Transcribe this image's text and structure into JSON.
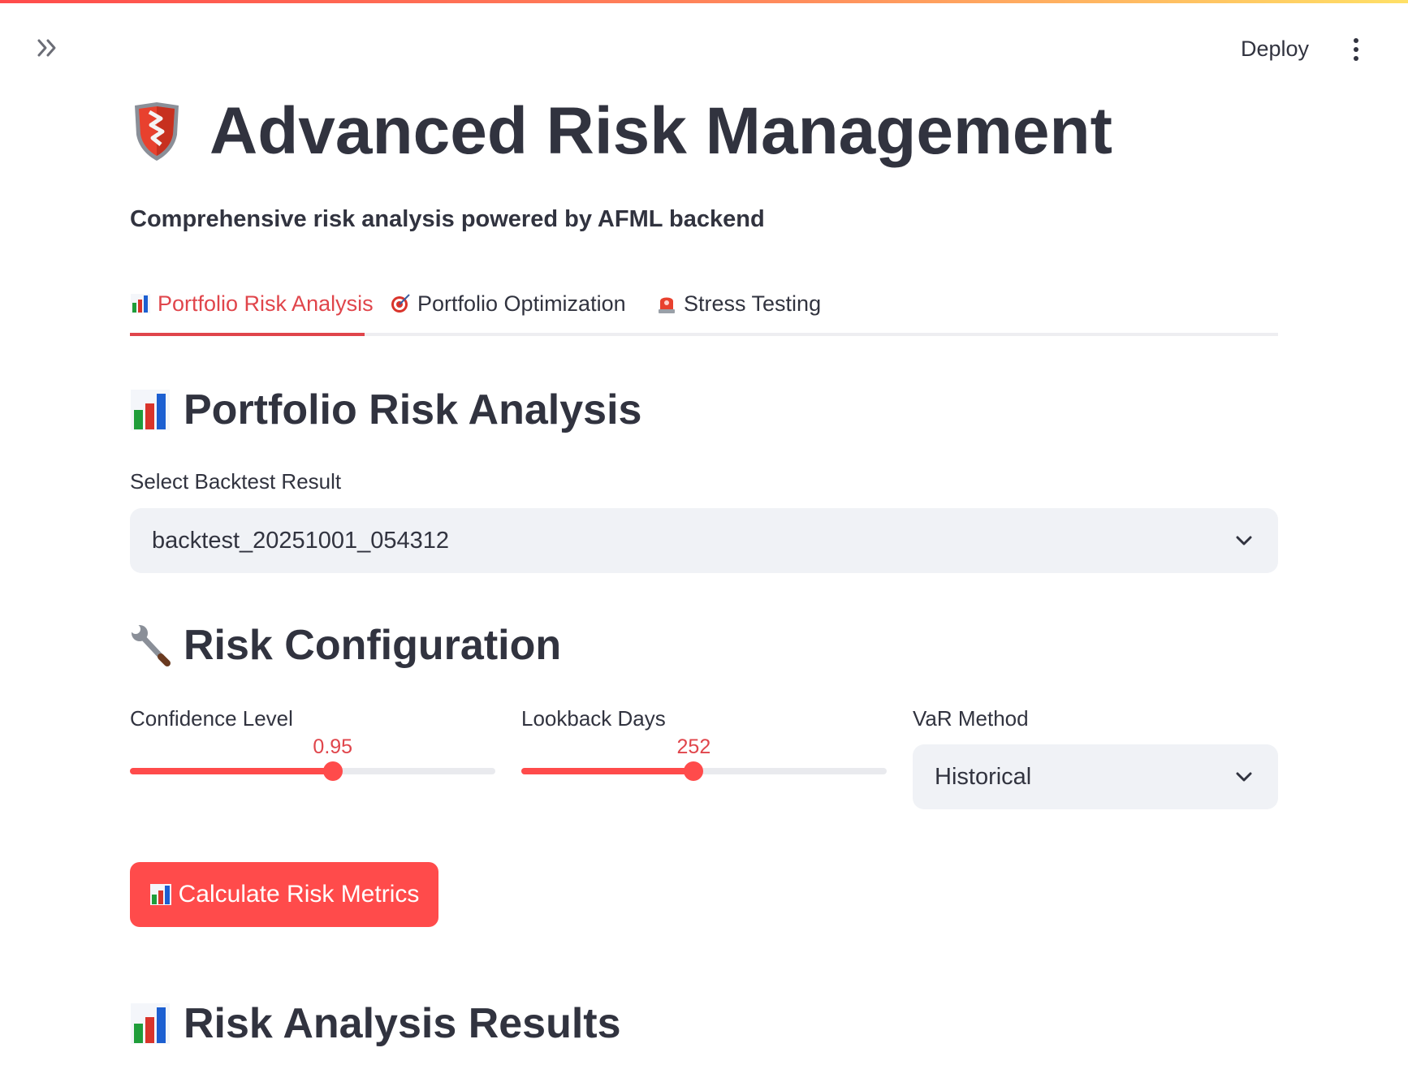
{
  "header": {
    "deploy_label": "Deploy",
    "expand_icon": "double-chevron-right-icon",
    "menu_icon": "vertical-dots-icon"
  },
  "page": {
    "title": "Advanced Risk Management",
    "title_icon": "shield-icon",
    "subtitle": "Comprehensive risk analysis powered by AFML backend"
  },
  "tabs": [
    {
      "label": "Portfolio Risk Analysis",
      "icon": "bar-chart-icon",
      "active": true
    },
    {
      "label": "Portfolio Optimization",
      "icon": "target-icon",
      "active": false
    },
    {
      "label": "Stress Testing",
      "icon": "siren-icon",
      "active": false
    }
  ],
  "analysis": {
    "heading": "Portfolio Risk Analysis",
    "select_label": "Select Backtest Result",
    "select_value": "backtest_20251001_054312"
  },
  "config": {
    "heading": "Risk Configuration",
    "confidence": {
      "label": "Confidence Level",
      "value": "0.95",
      "fraction": 0.555
    },
    "lookback": {
      "label": "Lookback Days",
      "value": "252",
      "fraction": 0.472
    },
    "var_method": {
      "label": "VaR Method",
      "value": "Historical"
    }
  },
  "actions": {
    "calculate_label": "Calculate Risk Metrics"
  },
  "results": {
    "heading": "Risk Analysis Results"
  },
  "colors": {
    "accent": "#ff4b4b",
    "tab_active": "#e0454b",
    "input_bg": "#f0f2f6"
  }
}
